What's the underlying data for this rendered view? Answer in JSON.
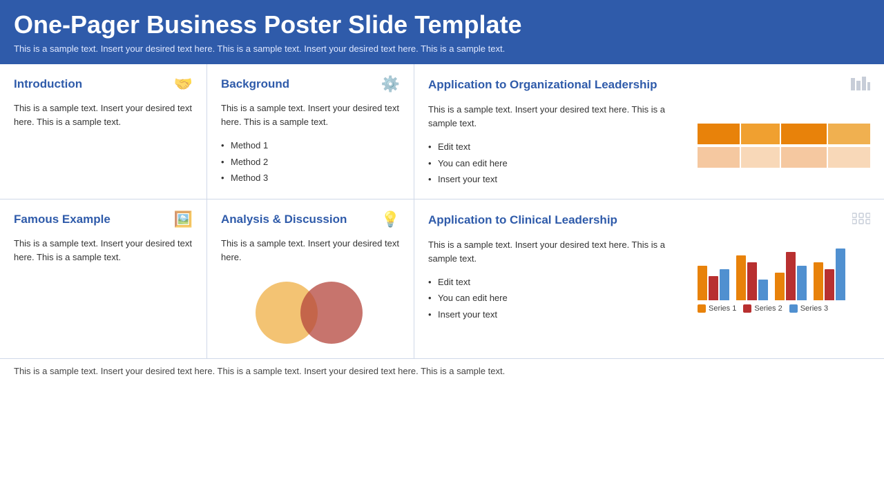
{
  "header": {
    "title": "One-Pager Business Poster Slide Template",
    "subtitle": "This is a sample text. Insert your desired text here. This is a sample text. Insert your desired text here. This is a sample text."
  },
  "footer": {
    "text": "This is a sample text. Insert your desired text here. This is a sample text. Insert your desired text here. This is a sample text."
  },
  "sections": {
    "introduction": {
      "title": "Introduction",
      "body": "This is a sample text. Insert your desired text here. This is a sample text.",
      "icon": "🤝"
    },
    "background": {
      "title": "Background",
      "body": "This is a sample text. Insert your desired text here. This is a sample text.",
      "icon": "⚙️",
      "list": [
        "Method 1",
        "Method 2",
        "Method 3"
      ]
    },
    "application_org": {
      "title": "Application to Organizational Leadership",
      "body": "This is a sample text. Insert your desired text here. This is a sample text.",
      "icon": "📊",
      "list": [
        "Edit text",
        "You can edit here",
        "Insert your text"
      ]
    },
    "famous_example": {
      "title": "Famous Example",
      "body": "This is a sample text. Insert your desired text here. This is a sample text.",
      "icon": "🖼️"
    },
    "analysis": {
      "title": "Analysis & Discussion",
      "body": "This is a sample text. Insert your desired text here.",
      "icon": "💡"
    },
    "application_clinical": {
      "title": "Application to Clinical Leadership",
      "body": "This is a sample text. Insert your desired text here. This is a sample text.",
      "icon": "🔀",
      "list": [
        "Edit text",
        "You can edit here",
        "Insert your text"
      ]
    }
  },
  "charts": {
    "horizontal_bar": {
      "row1_colors": [
        "#e8820a",
        "#f0a030",
        "#e8820a",
        "#f0b050"
      ],
      "row1_widths": [
        60,
        55,
        65,
        60
      ],
      "row2_colors": [
        "#f5c8a0",
        "#f8d8b8",
        "#f5c8a0",
        "#f8d8b8"
      ],
      "row2_widths": [
        60,
        55,
        65,
        60
      ]
    },
    "grouped_bar": {
      "groups": [
        {
          "s1": 50,
          "s2": 35,
          "s3": 45
        },
        {
          "s1": 65,
          "s2": 55,
          "s3": 30
        },
        {
          "s1": 40,
          "s2": 70,
          "s3": 50
        },
        {
          "s1": 55,
          "s2": 45,
          "s3": 75
        }
      ],
      "colors": {
        "s1": "#e8820a",
        "s2": "#b83030",
        "s3": "#5090d0"
      },
      "legend": [
        "Series 1",
        "Series 2",
        "Series 3"
      ]
    }
  }
}
